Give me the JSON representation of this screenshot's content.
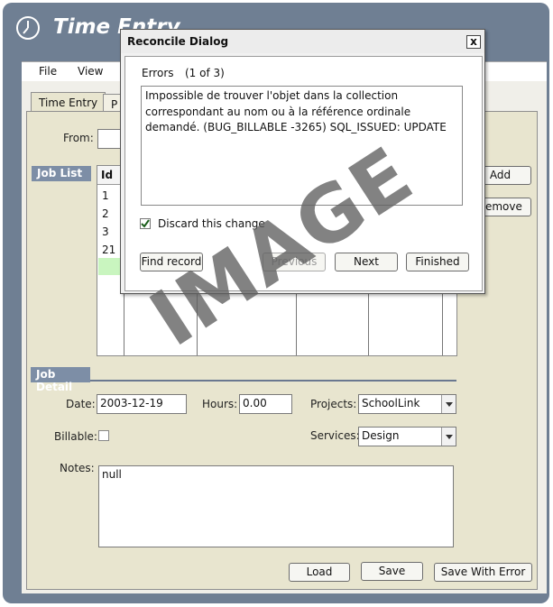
{
  "app": {
    "title": "Time Entry"
  },
  "menu": {
    "items": [
      "File",
      "View"
    ]
  },
  "tabs": [
    {
      "label": "Time Entry",
      "active": true
    },
    {
      "label": "P",
      "active": false
    }
  ],
  "filter": {
    "from_label": "From:",
    "from_value": ""
  },
  "job_list": {
    "header": "Job List",
    "columns": [
      "Id"
    ],
    "rows": [
      "1",
      "2",
      "3",
      "21",
      ""
    ],
    "add_label": "Add",
    "remove_label": "Remove"
  },
  "job_detail": {
    "header": "Job Detail",
    "date_label": "Date:",
    "date_value": "2003-12-19",
    "hours_label": "Hours:",
    "hours_value": "0.00",
    "projects_label": "Projects:",
    "projects_value": "SchoolLink",
    "billable_label": "Billable:",
    "billable_checked": false,
    "services_label": "Services:",
    "services_value": "Design",
    "notes_label": "Notes:",
    "notes_value": "null"
  },
  "footer": {
    "load_label": "Load",
    "save_label": "Save",
    "save_with_error_label": "Save With Error"
  },
  "dialog": {
    "title": "Reconcile Dialog",
    "close_label": "x",
    "errors_label": "Errors",
    "errors_count": "(1 of 3)",
    "error_text": "Impossible de trouver l'objet dans la collection correspondant au nom ou à la référence ordinale demandé. (BUG_BILLABLE -3265) SQL_ISSUED: UPDATE",
    "discard_label": "Discard this change",
    "discard_checked": true,
    "find_record_label": "Find record",
    "previous_label": "Previous",
    "next_label": "Next",
    "finished_label": "Finished"
  },
  "watermark": {
    "text": "IMAGE"
  },
  "colors": {
    "frame": "#6f7f93",
    "panel": "#e8e5cf",
    "section_header": "#7d8ea6",
    "row_highlight": "#c9f5bf"
  }
}
